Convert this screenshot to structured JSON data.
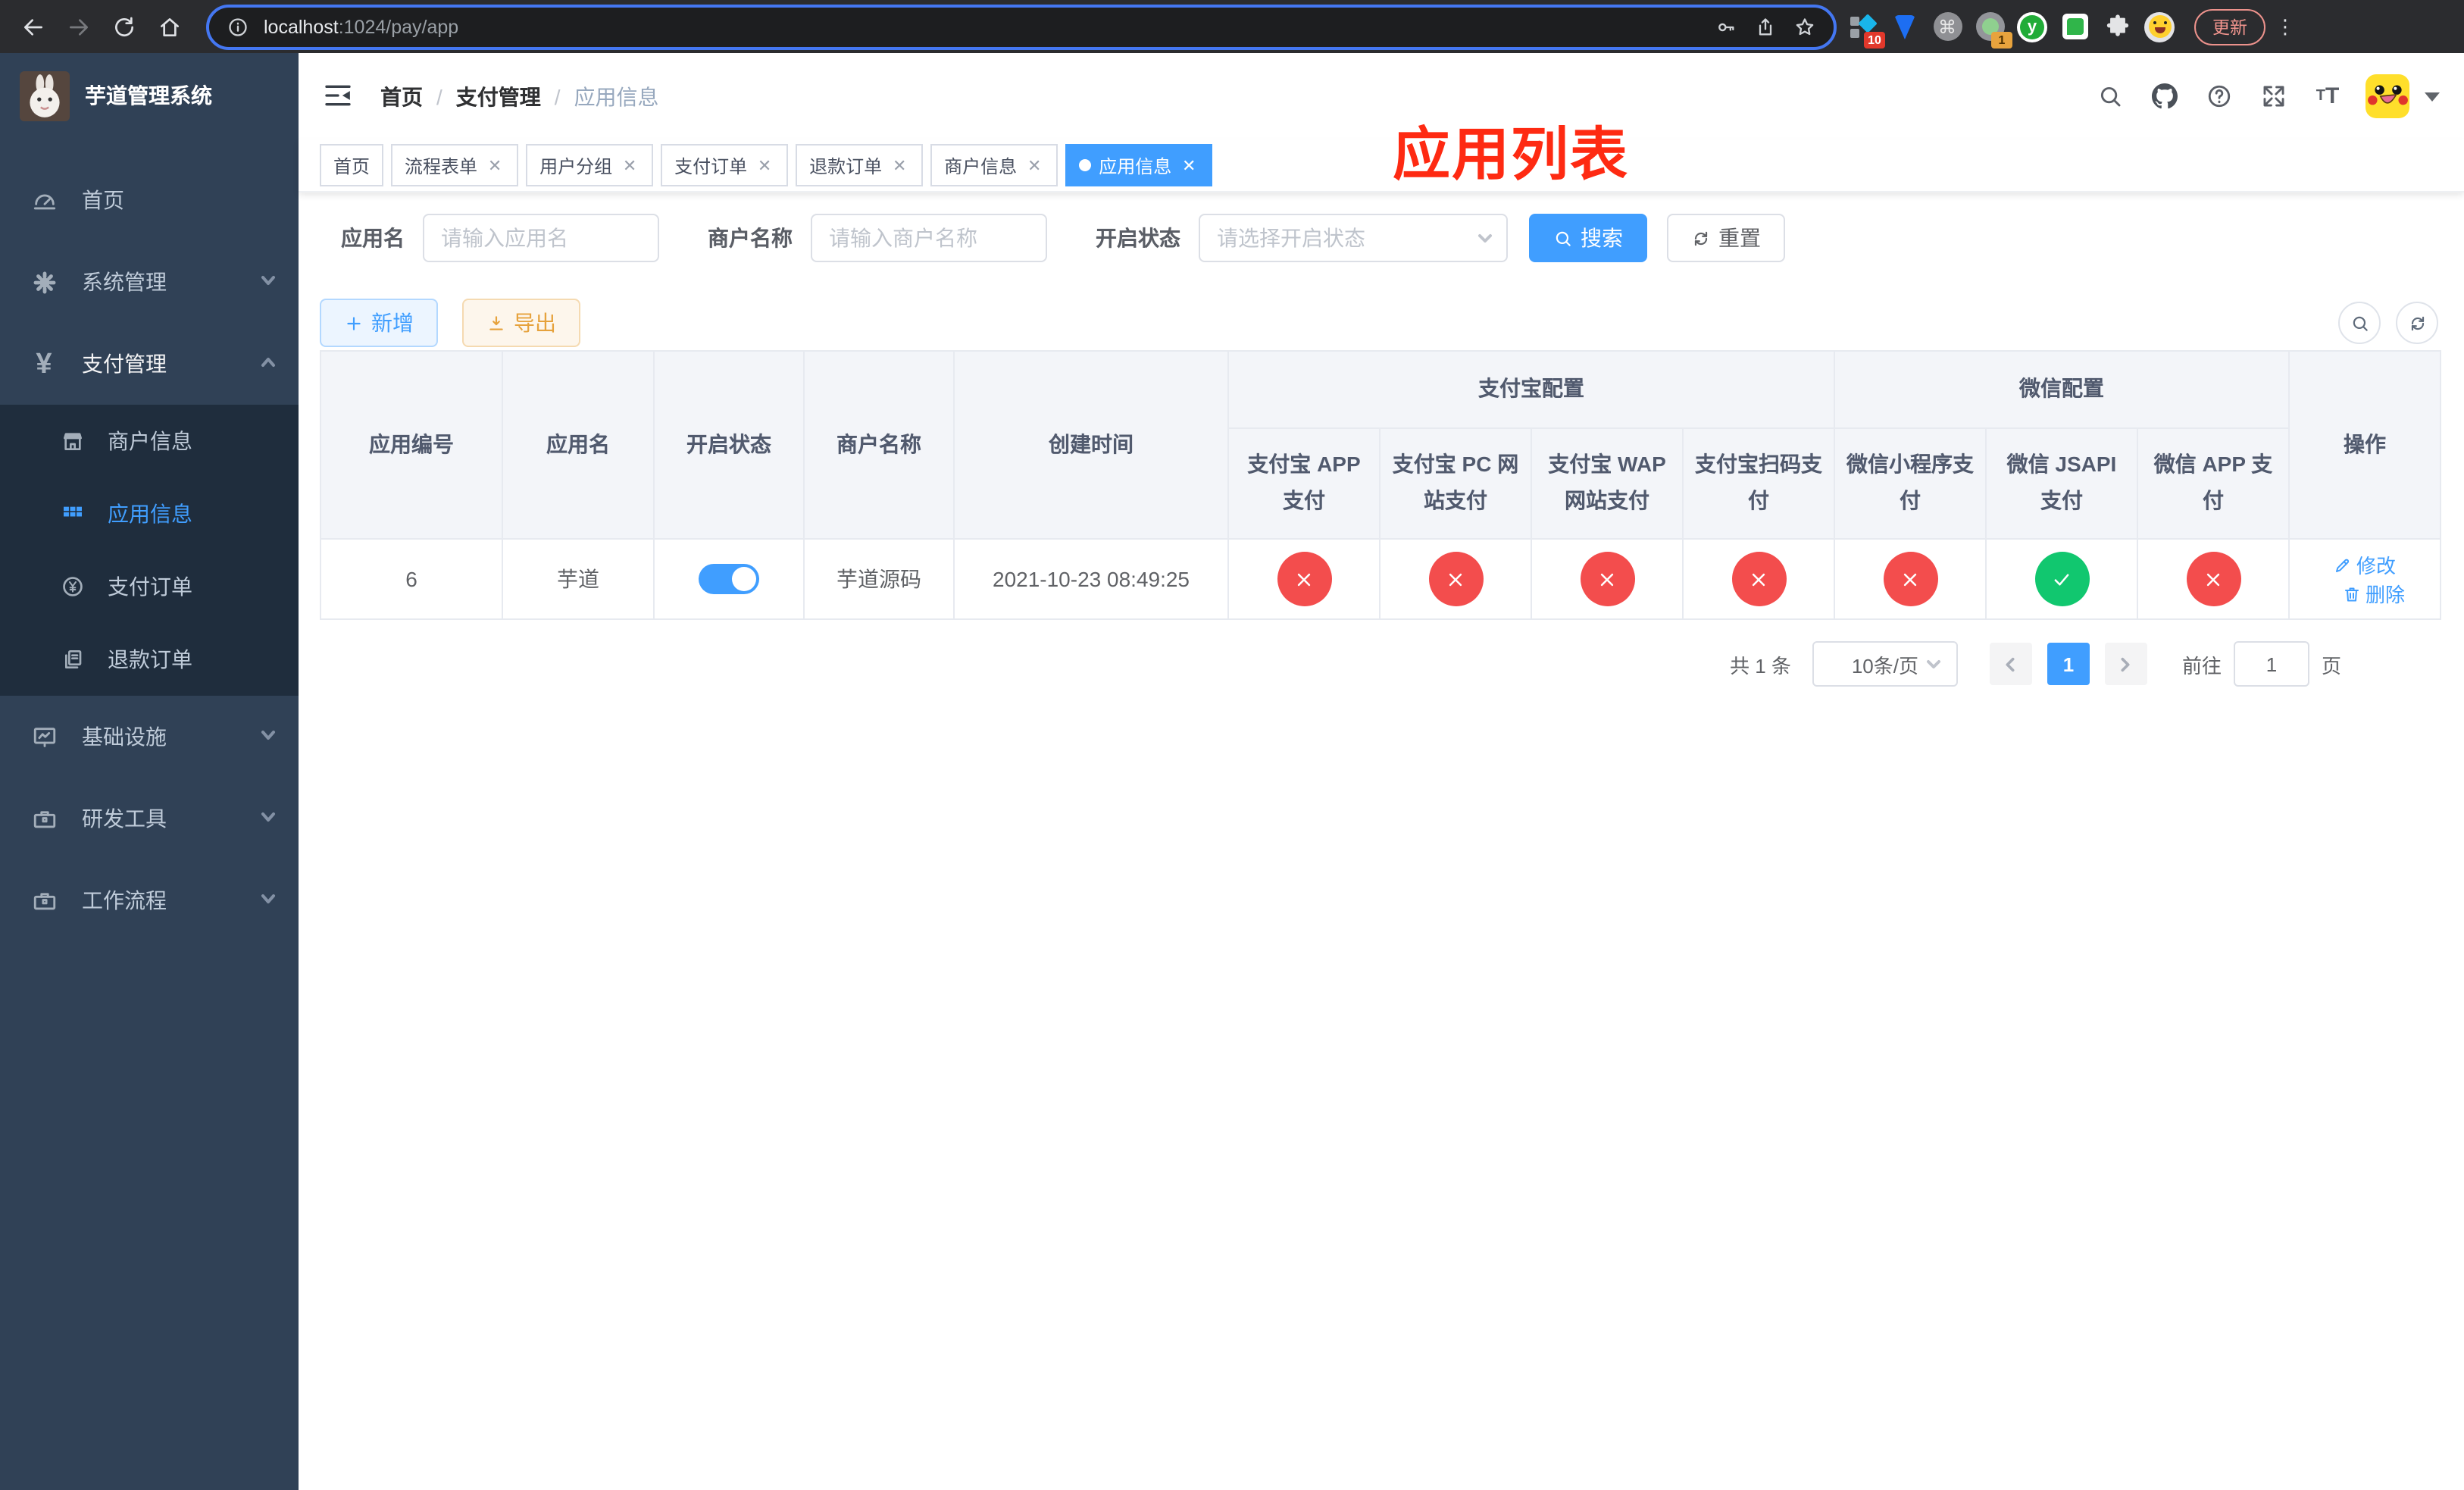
{
  "colors": {
    "accent": "#409eff",
    "success": "#11c76f",
    "danger": "#f34d4d",
    "warning": "#e6a23c",
    "annotation_red": "#fe2a12"
  },
  "browser": {
    "url_host": "localhost",
    "url_path": ":1024/pay/app",
    "update_button": "更新",
    "extension_badges": [
      "10",
      "1"
    ]
  },
  "annotation": {
    "title": "应用列表",
    "color": "#fe2a12"
  },
  "sidebar": {
    "app_title": "芋道管理系统",
    "menu": [
      {
        "label": "首页",
        "icon": "dashboard-icon"
      },
      {
        "label": "系统管理",
        "icon": "gear-icon"
      },
      {
        "label": "支付管理",
        "icon": "yen-icon",
        "expanded": true,
        "children": [
          {
            "label": "商户信息",
            "icon": "store-icon"
          },
          {
            "label": "应用信息",
            "icon": "grid-icon",
            "active": true
          },
          {
            "label": "支付订单",
            "icon": "yen-circle-icon"
          },
          {
            "label": "退款订单",
            "icon": "copy-icon"
          }
        ]
      },
      {
        "label": "基础设施",
        "icon": "monitor-icon"
      },
      {
        "label": "研发工具",
        "icon": "toolbox-icon"
      },
      {
        "label": "工作流程",
        "icon": "toolbox-icon"
      }
    ]
  },
  "navbar": {
    "breadcrumb": [
      "首页",
      "支付管理",
      "应用信息"
    ]
  },
  "tabs": [
    {
      "label": "首页",
      "closable": false,
      "active": false
    },
    {
      "label": "流程表单",
      "closable": true,
      "active": false
    },
    {
      "label": "用户分组",
      "closable": true,
      "active": false
    },
    {
      "label": "支付订单",
      "closable": true,
      "active": false
    },
    {
      "label": "退款订单",
      "closable": true,
      "active": false
    },
    {
      "label": "商户信息",
      "closable": true,
      "active": false
    },
    {
      "label": "应用信息",
      "closable": true,
      "active": true
    }
  ],
  "search": {
    "fields": [
      {
        "label": "应用名",
        "placeholder": "请输入应用名"
      },
      {
        "label": "商户名称",
        "placeholder": "请输入商户名称"
      },
      {
        "label": "开启状态",
        "placeholder": "请选择开启状态"
      }
    ],
    "search_button": "搜索",
    "reset_button": "重置"
  },
  "toolbar": {
    "add_button": "新增",
    "export_button": "导出"
  },
  "table": {
    "columns": {
      "app_id": "应用编号",
      "app_name": "应用名",
      "status": "开启状态",
      "merchant": "商户名称",
      "created": "创建时间",
      "op": "操作"
    },
    "group_headers": {
      "alipay": "支付宝配置",
      "wechat": "微信配置"
    },
    "pay_columns": [
      "支付宝 APP 支付",
      "支付宝 PC 网站支付",
      "支付宝 WAP 网站支付",
      "支付宝扫码支付",
      "微信小程序支付",
      "微信 JSAPI 支付",
      "微信 APP 支付"
    ],
    "rows": [
      {
        "app_id": "6",
        "app_name": "芋道",
        "enabled": true,
        "merchant": "芋道源码",
        "created": "2021-10-23 08:49:25",
        "pay_status": [
          false,
          false,
          false,
          false,
          false,
          true,
          false
        ],
        "edit_action": "修改",
        "delete_action": "删除"
      }
    ]
  },
  "pagination": {
    "total": "共 1 条",
    "page_size": "10条/页",
    "current_page": "1",
    "goto_label": "前往",
    "goto_value": "1",
    "unit": "页"
  }
}
